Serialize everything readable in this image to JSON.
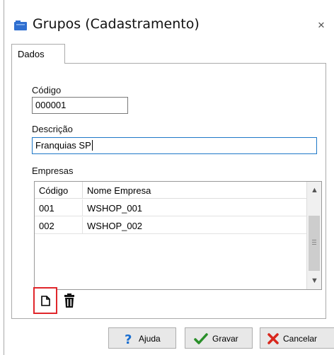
{
  "window": {
    "title": "Grupos (Cadastramento)",
    "close_glyph": "✕"
  },
  "tabs": [
    {
      "label": "Dados",
      "active": true
    }
  ],
  "form": {
    "codigo_label": "Código",
    "codigo_value": "000001",
    "descricao_label": "Descrição",
    "descricao_value": "Franquias SP",
    "empresas_label": "Empresas"
  },
  "grid": {
    "columns": [
      "Código",
      "Nome Empresa"
    ],
    "rows": [
      [
        "001",
        "WSHOP_001"
      ],
      [
        "002",
        "WSHOP_002"
      ]
    ]
  },
  "toolbar": {
    "new_icon": "new-document-icon",
    "delete_icon": "trash-icon",
    "highlight_color": "#e0262b"
  },
  "buttons": {
    "ajuda": "Ajuda",
    "gravar": "Gravar",
    "cancelar": "Cancelar"
  },
  "colors": {
    "focus_border": "#1e78c8",
    "help_icon": "#1b6fd0",
    "save_icon": "#2a8f2a",
    "cancel_icon": "#d8261c"
  }
}
